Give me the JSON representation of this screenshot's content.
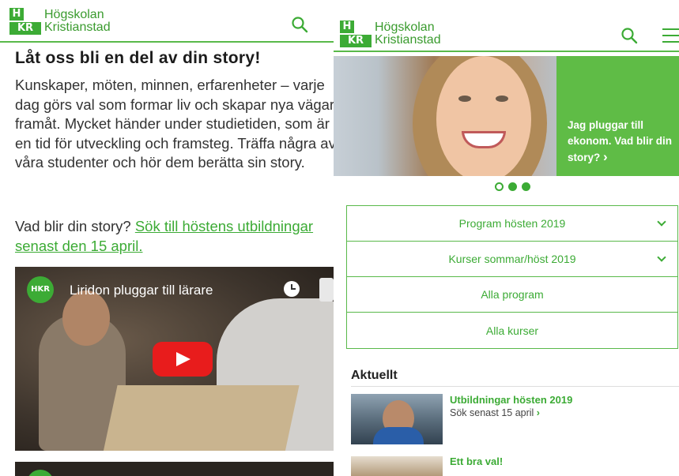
{
  "logo": {
    "mark_top": "H",
    "mark_bottom": "KR",
    "line1": "Högskolan",
    "line2": "Kristianstad"
  },
  "icons": {
    "search": "search-icon",
    "menu": "hamburger-menu-icon",
    "play": "play-icon",
    "clock": "clock-icon",
    "chevron": "chevron-down-icon",
    "arrow": "chevron-right-icon"
  },
  "colors": {
    "brand_green": "#3cab35",
    "rule_green": "#59b94a",
    "youtube_red": "#e81c1c"
  },
  "left": {
    "title": "Låt oss bli en del av din story!",
    "body": "Kunskaper, möten, minnen, erfarenheter – varje dag görs val som formar liv och skapar nya vägar framåt. Mycket händer under studietiden, som är en tid för utveckling och framsteg. Träffa några av våra studenter och hör dem berätta sin story.",
    "cta_prefix": "Vad blir din story? ",
    "cta_link": "Sök till höstens utbildningar senast den 15 april.",
    "video": {
      "title": "Liridon pluggar till lärare",
      "channel_logo": "HKR"
    }
  },
  "right": {
    "hero": {
      "text": "Jag pluggar till ekonom. Vad blir din story?",
      "arrow": "›"
    },
    "carousel": {
      "total": 3,
      "active": 1
    },
    "accordion": [
      {
        "label": "Program hösten 2019",
        "expandable": true
      },
      {
        "label": "Kurser sommar/höst 2019",
        "expandable": true
      },
      {
        "label": "Alla program",
        "expandable": false
      },
      {
        "label": "Alla kurser",
        "expandable": false
      }
    ],
    "news": {
      "heading": "Aktuellt",
      "items": [
        {
          "title": "Utbildningar hösten 2019",
          "subtitle": "Sök senast 15 april",
          "arrow": "›"
        },
        {
          "title": "Ett bra val!"
        }
      ]
    }
  }
}
